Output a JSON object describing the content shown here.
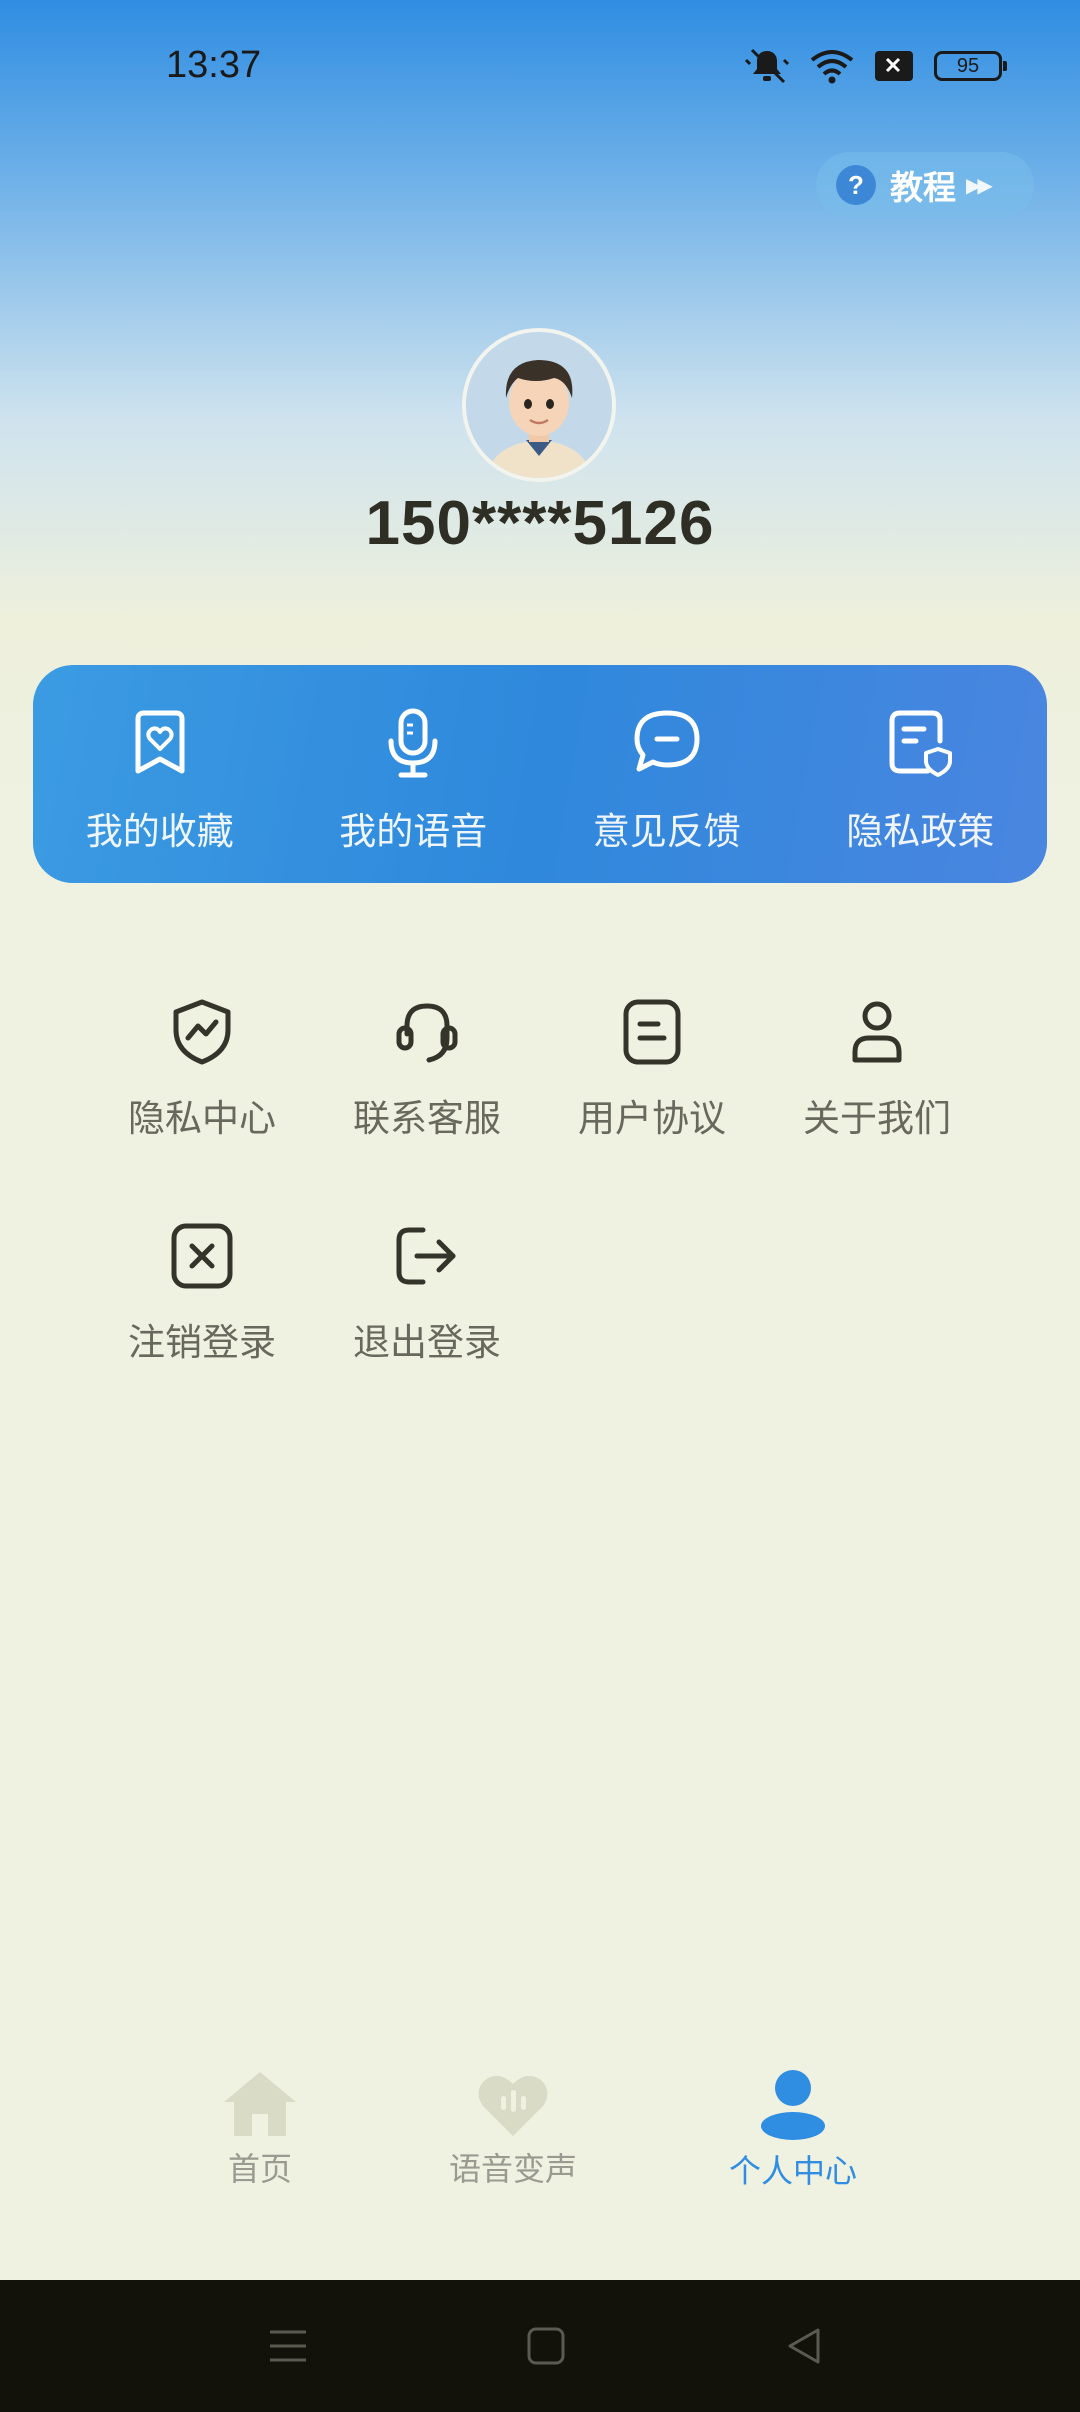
{
  "status_bar": {
    "time": "13:37",
    "battery": "95"
  },
  "tutorial": {
    "icon": "?",
    "label": "教程",
    "arrows": "▶▶"
  },
  "profile": {
    "phone": "150****5126"
  },
  "quick_actions": [
    {
      "label": "我的收藏",
      "icon": "bookmark-heart-icon"
    },
    {
      "label": "我的语音",
      "icon": "microphone-icon"
    },
    {
      "label": "意见反馈",
      "icon": "chat-bubble-icon"
    },
    {
      "label": "隐私政策",
      "icon": "document-shield-icon"
    }
  ],
  "menu": [
    {
      "label": "隐私中心",
      "icon": "shield-icon"
    },
    {
      "label": "联系客服",
      "icon": "headset-icon"
    },
    {
      "label": "用户协议",
      "icon": "document-icon"
    },
    {
      "label": "关于我们",
      "icon": "person-icon"
    },
    {
      "label": "注销登录",
      "icon": "close-box-icon"
    },
    {
      "label": "退出登录",
      "icon": "logout-icon"
    }
  ],
  "bottom_nav": [
    {
      "label": "首页",
      "icon": "home-icon",
      "active": false
    },
    {
      "label": "语音变声",
      "icon": "voice-heart-icon",
      "active": false
    },
    {
      "label": "个人中心",
      "icon": "person-icon",
      "active": true
    }
  ],
  "colors": {
    "accent": "#2f8de2",
    "text": "#2e2e24",
    "muted": "#68685c"
  }
}
